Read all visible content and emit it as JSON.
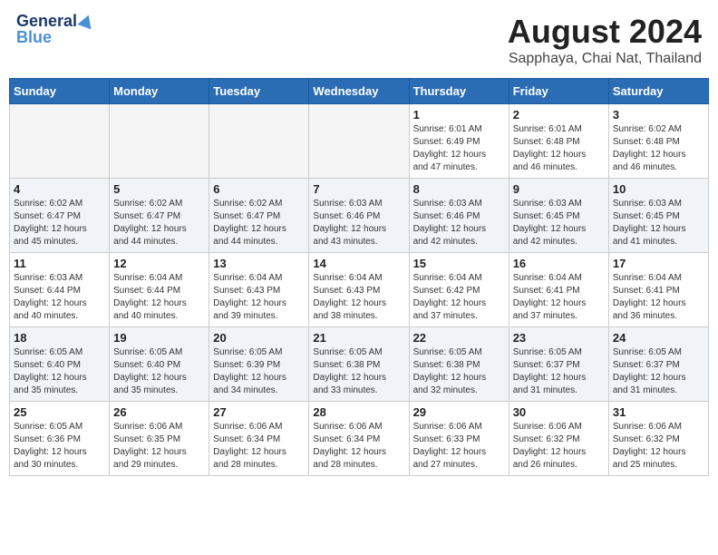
{
  "header": {
    "logo_line1": "General",
    "logo_line2": "Blue",
    "title": "August 2024",
    "subtitle": "Sapphaya, Chai Nat, Thailand"
  },
  "days_of_week": [
    "Sunday",
    "Monday",
    "Tuesday",
    "Wednesday",
    "Thursday",
    "Friday",
    "Saturday"
  ],
  "weeks": [
    [
      {
        "day": "",
        "info": ""
      },
      {
        "day": "",
        "info": ""
      },
      {
        "day": "",
        "info": ""
      },
      {
        "day": "",
        "info": ""
      },
      {
        "day": "1",
        "info": "Sunrise: 6:01 AM\nSunset: 6:49 PM\nDaylight: 12 hours\nand 47 minutes."
      },
      {
        "day": "2",
        "info": "Sunrise: 6:01 AM\nSunset: 6:48 PM\nDaylight: 12 hours\nand 46 minutes."
      },
      {
        "day": "3",
        "info": "Sunrise: 6:02 AM\nSunset: 6:48 PM\nDaylight: 12 hours\nand 46 minutes."
      }
    ],
    [
      {
        "day": "4",
        "info": "Sunrise: 6:02 AM\nSunset: 6:47 PM\nDaylight: 12 hours\nand 45 minutes."
      },
      {
        "day": "5",
        "info": "Sunrise: 6:02 AM\nSunset: 6:47 PM\nDaylight: 12 hours\nand 44 minutes."
      },
      {
        "day": "6",
        "info": "Sunrise: 6:02 AM\nSunset: 6:47 PM\nDaylight: 12 hours\nand 44 minutes."
      },
      {
        "day": "7",
        "info": "Sunrise: 6:03 AM\nSunset: 6:46 PM\nDaylight: 12 hours\nand 43 minutes."
      },
      {
        "day": "8",
        "info": "Sunrise: 6:03 AM\nSunset: 6:46 PM\nDaylight: 12 hours\nand 42 minutes."
      },
      {
        "day": "9",
        "info": "Sunrise: 6:03 AM\nSunset: 6:45 PM\nDaylight: 12 hours\nand 42 minutes."
      },
      {
        "day": "10",
        "info": "Sunrise: 6:03 AM\nSunset: 6:45 PM\nDaylight: 12 hours\nand 41 minutes."
      }
    ],
    [
      {
        "day": "11",
        "info": "Sunrise: 6:03 AM\nSunset: 6:44 PM\nDaylight: 12 hours\nand 40 minutes."
      },
      {
        "day": "12",
        "info": "Sunrise: 6:04 AM\nSunset: 6:44 PM\nDaylight: 12 hours\nand 40 minutes."
      },
      {
        "day": "13",
        "info": "Sunrise: 6:04 AM\nSunset: 6:43 PM\nDaylight: 12 hours\nand 39 minutes."
      },
      {
        "day": "14",
        "info": "Sunrise: 6:04 AM\nSunset: 6:43 PM\nDaylight: 12 hours\nand 38 minutes."
      },
      {
        "day": "15",
        "info": "Sunrise: 6:04 AM\nSunset: 6:42 PM\nDaylight: 12 hours\nand 37 minutes."
      },
      {
        "day": "16",
        "info": "Sunrise: 6:04 AM\nSunset: 6:41 PM\nDaylight: 12 hours\nand 37 minutes."
      },
      {
        "day": "17",
        "info": "Sunrise: 6:04 AM\nSunset: 6:41 PM\nDaylight: 12 hours\nand 36 minutes."
      }
    ],
    [
      {
        "day": "18",
        "info": "Sunrise: 6:05 AM\nSunset: 6:40 PM\nDaylight: 12 hours\nand 35 minutes."
      },
      {
        "day": "19",
        "info": "Sunrise: 6:05 AM\nSunset: 6:40 PM\nDaylight: 12 hours\nand 35 minutes."
      },
      {
        "day": "20",
        "info": "Sunrise: 6:05 AM\nSunset: 6:39 PM\nDaylight: 12 hours\nand 34 minutes."
      },
      {
        "day": "21",
        "info": "Sunrise: 6:05 AM\nSunset: 6:38 PM\nDaylight: 12 hours\nand 33 minutes."
      },
      {
        "day": "22",
        "info": "Sunrise: 6:05 AM\nSunset: 6:38 PM\nDaylight: 12 hours\nand 32 minutes."
      },
      {
        "day": "23",
        "info": "Sunrise: 6:05 AM\nSunset: 6:37 PM\nDaylight: 12 hours\nand 31 minutes."
      },
      {
        "day": "24",
        "info": "Sunrise: 6:05 AM\nSunset: 6:37 PM\nDaylight: 12 hours\nand 31 minutes."
      }
    ],
    [
      {
        "day": "25",
        "info": "Sunrise: 6:05 AM\nSunset: 6:36 PM\nDaylight: 12 hours\nand 30 minutes."
      },
      {
        "day": "26",
        "info": "Sunrise: 6:06 AM\nSunset: 6:35 PM\nDaylight: 12 hours\nand 29 minutes."
      },
      {
        "day": "27",
        "info": "Sunrise: 6:06 AM\nSunset: 6:34 PM\nDaylight: 12 hours\nand 28 minutes."
      },
      {
        "day": "28",
        "info": "Sunrise: 6:06 AM\nSunset: 6:34 PM\nDaylight: 12 hours\nand 28 minutes."
      },
      {
        "day": "29",
        "info": "Sunrise: 6:06 AM\nSunset: 6:33 PM\nDaylight: 12 hours\nand 27 minutes."
      },
      {
        "day": "30",
        "info": "Sunrise: 6:06 AM\nSunset: 6:32 PM\nDaylight: 12 hours\nand 26 minutes."
      },
      {
        "day": "31",
        "info": "Sunrise: 6:06 AM\nSunset: 6:32 PM\nDaylight: 12 hours\nand 25 minutes."
      }
    ]
  ]
}
